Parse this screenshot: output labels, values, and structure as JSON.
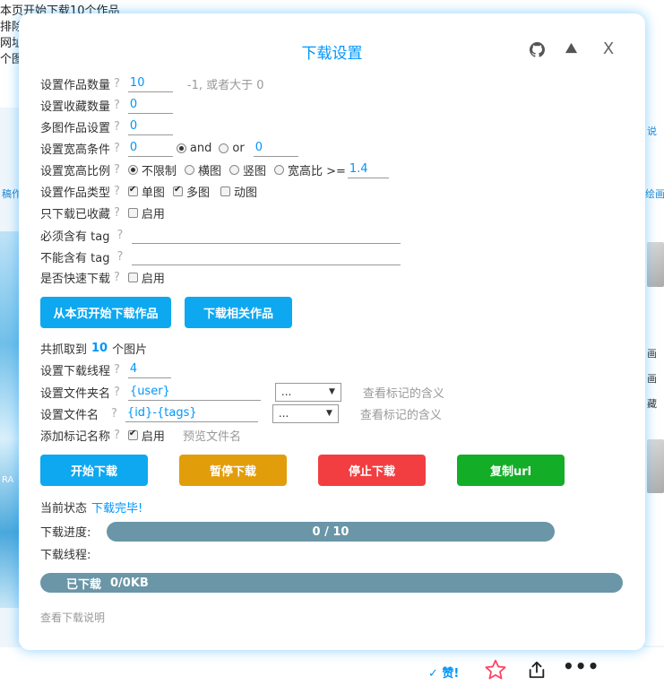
{
  "background": {
    "top_lines": [
      "本页开始下载10个作品",
      "排除",
      "网址",
      "个图"
    ],
    "right_links": [
      "说",
      "绘画",
      "画",
      "画",
      "藏"
    ],
    "left_label": "稿作",
    "left_art_text": "RA",
    "like_label": "✓ 赞!"
  },
  "modal": {
    "title": "下载设置",
    "help_mark": "?",
    "fields": {
      "work_count": {
        "label": "设置作品数量",
        "value": "10",
        "hint": "-1, 或者大于 0"
      },
      "bookmark_count": {
        "label": "设置收藏数量",
        "value": "0"
      },
      "multi_image": {
        "label": "多图作品设置",
        "value": "0"
      },
      "size_cond": {
        "label": "设置宽高条件",
        "width": "0",
        "and_label": "and",
        "or_label": "or",
        "height": "0",
        "selected": "and"
      },
      "ratio": {
        "label": "设置宽高比例",
        "options": [
          "不限制",
          "横图",
          "竖图",
          "宽高比 >="
        ],
        "selected": "不限制",
        "ratio_value": "1.4"
      },
      "work_type": {
        "label": "设置作品类型",
        "options": [
          {
            "label": "单图",
            "checked": true
          },
          {
            "label": "多图",
            "checked": true
          },
          {
            "label": "动图",
            "checked": false
          }
        ]
      },
      "only_bookmarked": {
        "label": "只下载已收藏",
        "option": "启用",
        "checked": false
      },
      "must_tag": {
        "label": "必须含有 tag",
        "value": ""
      },
      "exclude_tag": {
        "label": "不能含有 tag",
        "value": ""
      },
      "quick_download": {
        "label": "是否快速下载",
        "option": "启用",
        "checked": false
      }
    },
    "buttons": {
      "start_from_page": "从本页开始下载作品",
      "download_related": "下载相关作品"
    },
    "fetched": {
      "prefix": "共抓取到",
      "count": "10",
      "suffix": "个图片"
    },
    "threads": {
      "label": "设置下载线程",
      "value": "4"
    },
    "folder_name": {
      "label": "设置文件夹名",
      "value": "{user}",
      "select": "...",
      "link": "查看标记的含义"
    },
    "file_name": {
      "label": "设置文件名",
      "value": "{id}-{tags}",
      "select": "...",
      "link": "查看标记的含义"
    },
    "tag_name": {
      "label": "添加标记名称",
      "option": "启用",
      "checked": true,
      "preview": "预览文件名"
    },
    "actions": {
      "start": "开始下载",
      "pause": "暂停下载",
      "stop": "停止下载",
      "copy": "复制url"
    },
    "status": {
      "label": "当前状态",
      "value": "下载完毕!"
    },
    "progress": {
      "label": "下载进度:",
      "text": "0 / 10",
      "fraction": 0
    },
    "thread_label": "下载线程:",
    "downloaded": {
      "label": "已下载",
      "value": "0/0KB",
      "fraction": 0
    },
    "help_link": "查看下载说明"
  },
  "colors": {
    "accent": "#0096fa",
    "start": "#0ea8f0",
    "pause": "#e29d0a",
    "stop": "#f23e40",
    "copy": "#14ad27",
    "bar": "#6a96a7"
  }
}
